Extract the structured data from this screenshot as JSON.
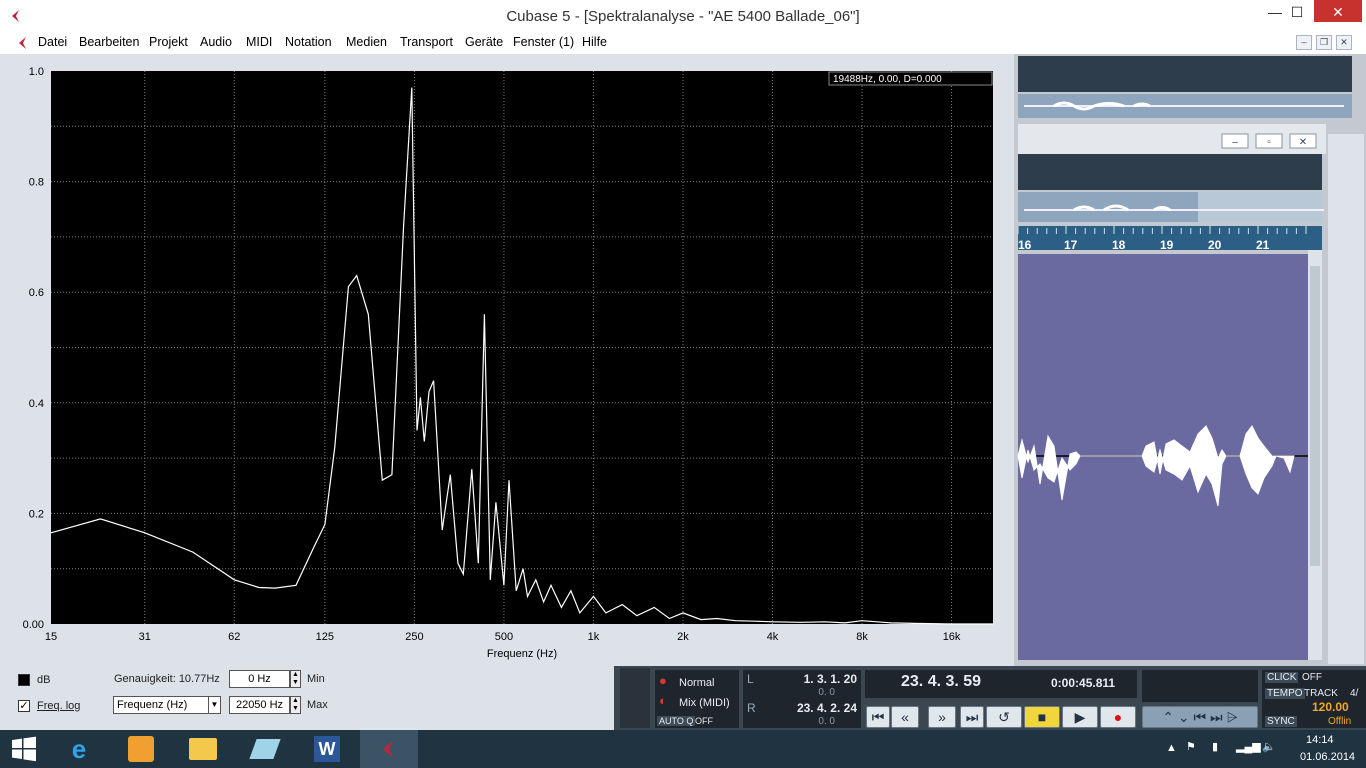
{
  "window": {
    "title": "Cubase 5 - [Spektralanalyse - \"AE 5400 Ballade_06\"]"
  },
  "menu": [
    "Datei",
    "Bearbeiten",
    "Projekt",
    "Audio",
    "MIDI",
    "Notation",
    "Medien",
    "Transport",
    "Geräte",
    "Fenster (1)",
    "Hilfe"
  ],
  "colors": {
    "plot_bg": "#000000",
    "plot_line": "#ffffff",
    "accent": "#c0243c",
    "close": "#c7312e",
    "editor_bg": "#6a6aa0",
    "ruler": "#2b5f86"
  },
  "spectrum": {
    "readout": "19488Hz, 0.00, D=0.000",
    "x_label": "Frequenz (Hz)",
    "x_ticks": [
      "15",
      "31",
      "62",
      "125",
      "250",
      "500",
      "1k",
      "2k",
      "4k",
      "8k",
      "16k"
    ],
    "y_ticks": [
      "1.0",
      "0.8",
      "0.6",
      "0.4",
      "0.2",
      "0.00"
    ],
    "chart_data": {
      "type": "line",
      "xlabel": "Frequenz (Hz)",
      "x_scale": "log",
      "xlim": [
        15,
        22050
      ],
      "ylim": [
        0,
        1.0
      ],
      "grid": true,
      "x": [
        15,
        22,
        31,
        45,
        62,
        75,
        85,
        100,
        115,
        125,
        135,
        150,
        160,
        175,
        195,
        210,
        230,
        245,
        255,
        262,
        270,
        280,
        290,
        310,
        330,
        350,
        365,
        390,
        410,
        430,
        450,
        470,
        500,
        520,
        550,
        580,
        600,
        640,
        680,
        720,
        780,
        840,
        900,
        1000,
        1100,
        1250,
        1400,
        1600,
        1800,
        2000,
        2300,
        2600,
        3000,
        3500,
        4000,
        5000,
        6000,
        7000,
        8000,
        10000,
        12000,
        16000,
        22050
      ],
      "values": [
        0.165,
        0.19,
        0.165,
        0.13,
        0.08,
        0.066,
        0.065,
        0.07,
        0.14,
        0.18,
        0.32,
        0.61,
        0.63,
        0.56,
        0.26,
        0.27,
        0.72,
        0.97,
        0.35,
        0.41,
        0.33,
        0.42,
        0.44,
        0.17,
        0.27,
        0.11,
        0.09,
        0.28,
        0.11,
        0.56,
        0.08,
        0.22,
        0.07,
        0.26,
        0.06,
        0.1,
        0.05,
        0.08,
        0.04,
        0.07,
        0.03,
        0.06,
        0.02,
        0.05,
        0.02,
        0.035,
        0.015,
        0.03,
        0.01,
        0.02,
        0.008,
        0.01,
        0.006,
        0.005,
        0.004,
        0.003,
        0.004,
        0.002,
        0.006,
        0.002,
        0.001,
        0.0,
        0.0
      ]
    }
  },
  "controls": {
    "db_label": "dB",
    "freq_log_label": "Freq. log",
    "genauigkeit": "Genauigkeit: 10.77Hz",
    "min_value": "0 Hz",
    "min_label": "Min",
    "max_value": "22050 Hz",
    "max_label": "Max",
    "freq_select": "Frequenz (Hz)"
  },
  "editor": {
    "ruler": [
      "16",
      "17",
      "18",
      "19",
      "20",
      "21"
    ]
  },
  "transport": {
    "mode": "Normal",
    "mix": "Mix (MIDI)",
    "autoq": "AUTO Q",
    "autoq_val": "OFF",
    "left_locator": "1. 3. 1. 20",
    "left_small": "0.   0",
    "right_locator": "23. 4. 2. 24",
    "right_small": "0.   0",
    "position": "23. 4. 3. 59",
    "time": "0:00:45.811",
    "click": "CLICK",
    "click_val": "OFF",
    "tempo": "TEMPO",
    "track": "TRACK",
    "tempo_val": "120.00",
    "track_val": "4/",
    "sync": "SYNC",
    "offline": "Offlin"
  },
  "taskbar": {
    "time": "14:14",
    "date": "01.06.2014"
  }
}
